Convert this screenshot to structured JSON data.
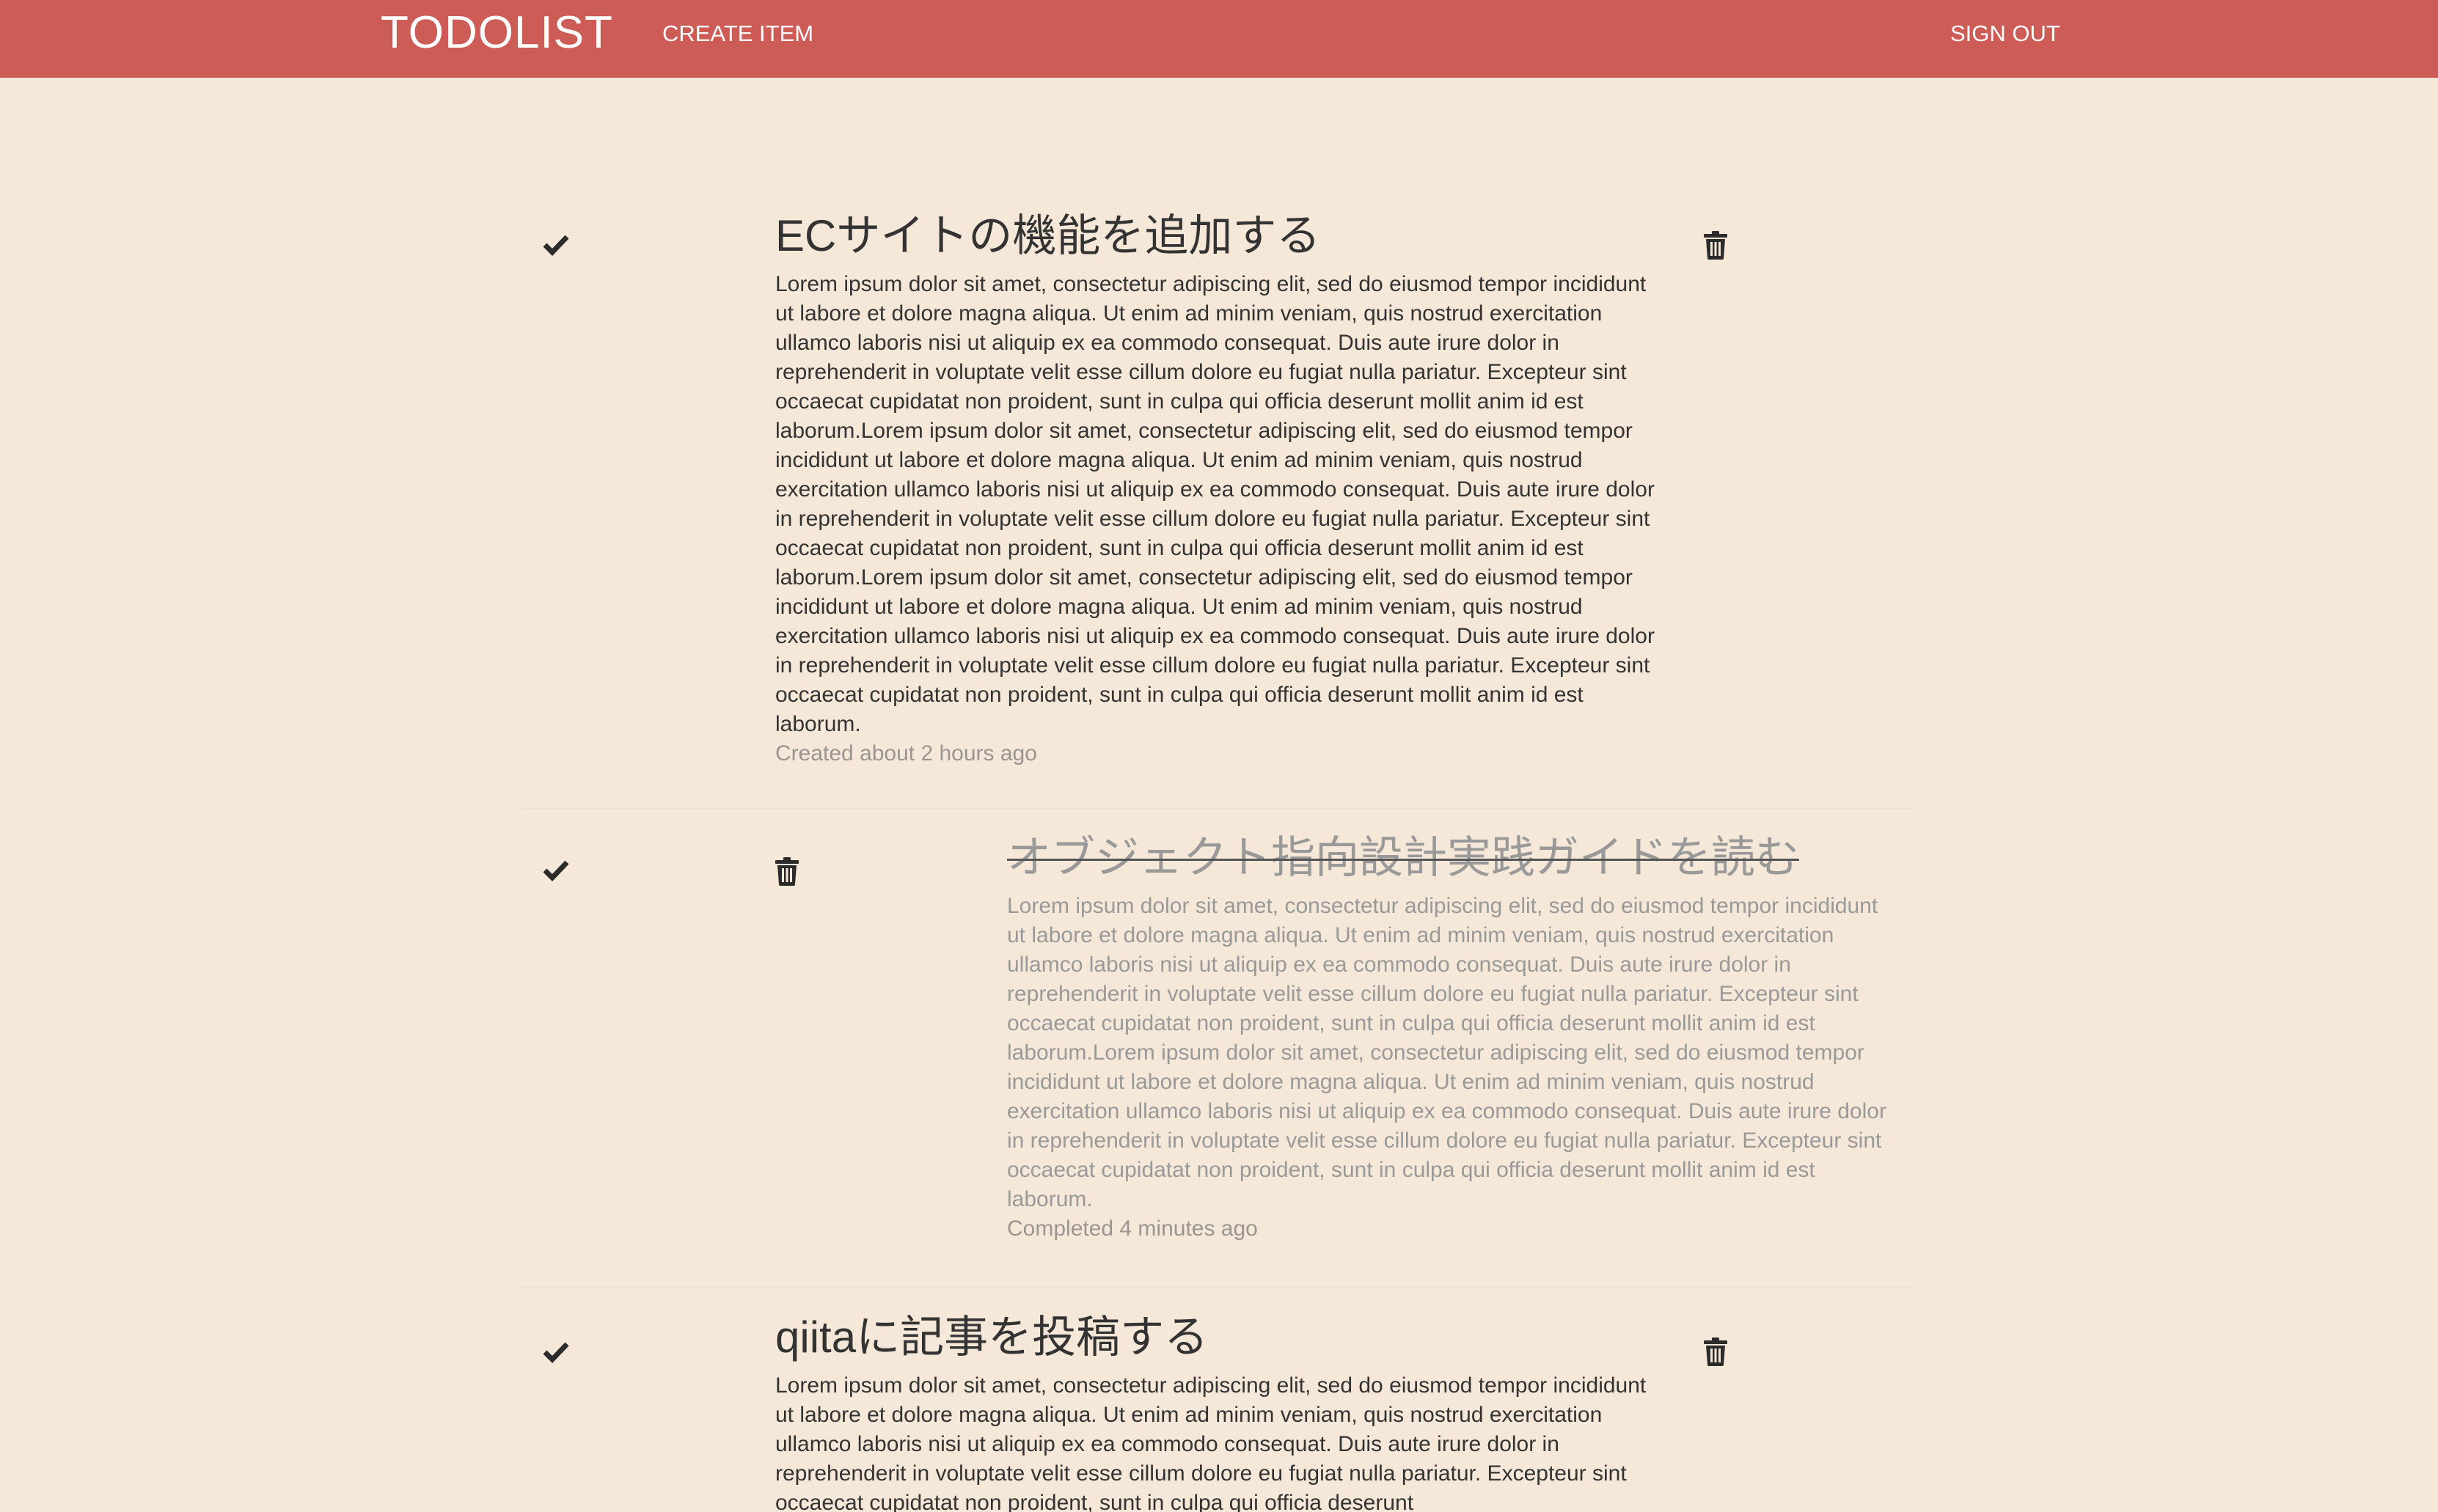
{
  "navbar": {
    "brand": "TODOLIST",
    "create_item": "CREATE ITEM",
    "sign_out": "SIGN OUT",
    "background_color": "#cd5c56"
  },
  "page": {
    "background_color": "#f5e8d8"
  },
  "todos": [
    {
      "title": "ECサイトの機能を追加する",
      "description": "Lorem ipsum dolor sit amet, consectetur adipiscing elit, sed do eiusmod tempor incididunt ut labore et dolore magna aliqua. Ut enim ad minim veniam, quis nostrud exercitation ullamco laboris nisi ut aliquip ex ea commodo consequat. Duis aute irure dolor in reprehenderit in voluptate velit esse cillum dolore eu fugiat nulla pariatur. Excepteur sint occaecat cupidatat non proident, sunt in culpa qui officia deserunt mollit anim id est laborum.Lorem ipsum dolor sit amet, consectetur adipiscing elit, sed do eiusmod tempor incididunt ut labore et dolore magna aliqua. Ut enim ad minim veniam, quis nostrud exercitation ullamco laboris nisi ut aliquip ex ea commodo consequat. Duis aute irure dolor in reprehenderit in voluptate velit esse cillum dolore eu fugiat nulla pariatur. Excepteur sint occaecat cupidatat non proident, sunt in culpa qui officia deserunt mollit anim id est laborum.Lorem ipsum dolor sit amet, consectetur adipiscing elit, sed do eiusmod tempor incididunt ut labore et dolore magna aliqua. Ut enim ad minim veniam, quis nostrud exercitation ullamco laboris nisi ut aliquip ex ea commodo consequat. Duis aute irure dolor in reprehenderit in voluptate velit esse cillum dolore eu fugiat nulla pariatur. Excepteur sint occaecat cupidatat non proident, sunt in culpa qui officia deserunt mollit anim id est laborum.",
      "meta": "Created about 2 hours ago",
      "check_icon": "check-icon",
      "delete_icon": "trash-icon",
      "completed": false
    },
    {
      "title": "オブジェクト指向設計実践ガイドを読む",
      "description": "Lorem ipsum dolor sit amet, consectetur adipiscing elit, sed do eiusmod tempor incididunt ut labore et dolore magna aliqua. Ut enim ad minim veniam, quis nostrud exercitation ullamco laboris nisi ut aliquip ex ea commodo consequat. Duis aute irure dolor in reprehenderit in voluptate velit esse cillum dolore eu fugiat nulla pariatur. Excepteur sint occaecat cupidatat non proident, sunt in culpa qui officia deserunt mollit anim id est laborum.Lorem ipsum dolor sit amet, consectetur adipiscing elit, sed do eiusmod tempor incididunt ut labore et dolore magna aliqua. Ut enim ad minim veniam, quis nostrud exercitation ullamco laboris nisi ut aliquip ex ea commodo consequat. Duis aute irure dolor in reprehenderit in voluptate velit esse cillum dolore eu fugiat nulla pariatur. Excepteur sint occaecat cupidatat non proident, sunt in culpa qui officia deserunt mollit anim id est laborum.",
      "meta": "Completed 4 minutes ago",
      "check_icon": "check-icon",
      "delete_icon": "trash-icon",
      "completed": true
    },
    {
      "title": "qiitaに記事を投稿する",
      "description": "Lorem ipsum dolor sit amet, consectetur adipiscing elit, sed do eiusmod tempor incididunt ut labore et dolore magna aliqua. Ut enim ad minim veniam, quis nostrud exercitation ullamco laboris nisi ut aliquip ex ea commodo consequat. Duis aute irure dolor in reprehenderit in voluptate velit esse cillum dolore eu fugiat nulla pariatur. Excepteur sint occaecat cupidatat non proident, sunt in culpa qui officia deserunt",
      "meta": "",
      "check_icon": "check-icon",
      "delete_icon": "trash-icon",
      "completed": false
    }
  ]
}
